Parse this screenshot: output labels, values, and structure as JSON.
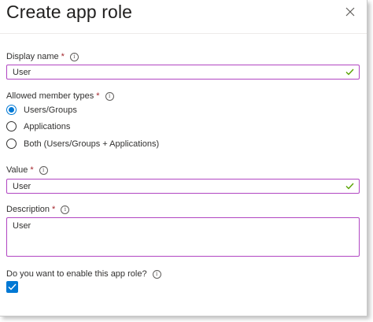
{
  "panel": {
    "title": "Create app role"
  },
  "display_name": {
    "label": "Display name",
    "required_mark": "*",
    "value": "User"
  },
  "member_types": {
    "label": "Allowed member types",
    "required_mark": "*",
    "options": [
      {
        "label": "Users/Groups",
        "selected": true
      },
      {
        "label": "Applications",
        "selected": false
      },
      {
        "label": "Both (Users/Groups + Applications)",
        "selected": false
      }
    ]
  },
  "value_field": {
    "label": "Value",
    "required_mark": "*",
    "value": "User"
  },
  "description": {
    "label": "Description",
    "required_mark": "*",
    "value": "User"
  },
  "enable": {
    "label": "Do you want to enable this app role?",
    "checked": true
  },
  "icons": {
    "info": "i",
    "close": "close-icon",
    "valid": "checkmark-icon"
  },
  "colors": {
    "focus_border": "#b146c2",
    "accent": "#0078d4",
    "valid_check": "#57a300",
    "required": "#a4262c"
  }
}
